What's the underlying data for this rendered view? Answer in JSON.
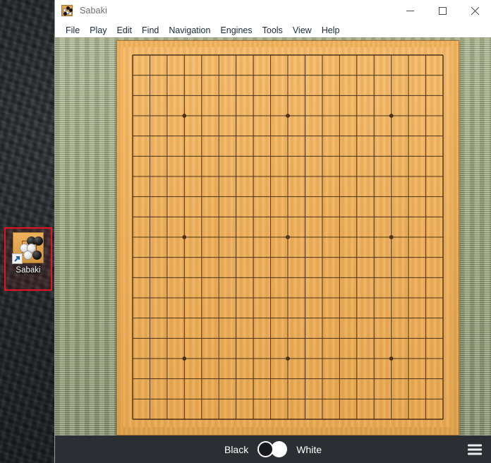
{
  "desktop": {
    "icon": {
      "label": "Sabaki",
      "art_name": "go-board-stones-icon",
      "shortcut_overlay": "shortcut-arrow-icon",
      "selected": true,
      "selection_color": "#e81123"
    }
  },
  "window": {
    "title": "Sabaki",
    "app_icon": "sabaki-go-board-icon",
    "controls": {
      "minimize": "—",
      "maximize": "□",
      "close": "✕"
    },
    "menu": [
      {
        "label": "File"
      },
      {
        "label": "Play"
      },
      {
        "label": "Edit"
      },
      {
        "label": "Find"
      },
      {
        "label": "Navigation"
      },
      {
        "label": "Engines"
      },
      {
        "label": "Tools"
      },
      {
        "label": "View"
      },
      {
        "label": "Help"
      }
    ]
  },
  "board": {
    "size": 19,
    "lines": 19,
    "star_points": [
      [
        3,
        3
      ],
      [
        9,
        3
      ],
      [
        15,
        3
      ],
      [
        3,
        9
      ],
      [
        9,
        9
      ],
      [
        15,
        9
      ],
      [
        3,
        15
      ],
      [
        9,
        15
      ],
      [
        15,
        15
      ]
    ],
    "stones": [],
    "wood_color": "#eeb15c",
    "line_color": "#4a3117",
    "mat_color": "#93a070"
  },
  "bottombar": {
    "black_label": "Black",
    "white_label": "White",
    "active_player": "Black",
    "toggle_name": "player-color-toggle",
    "menu_icon": "hamburger-menu-icon",
    "background": "#2b2e33"
  }
}
